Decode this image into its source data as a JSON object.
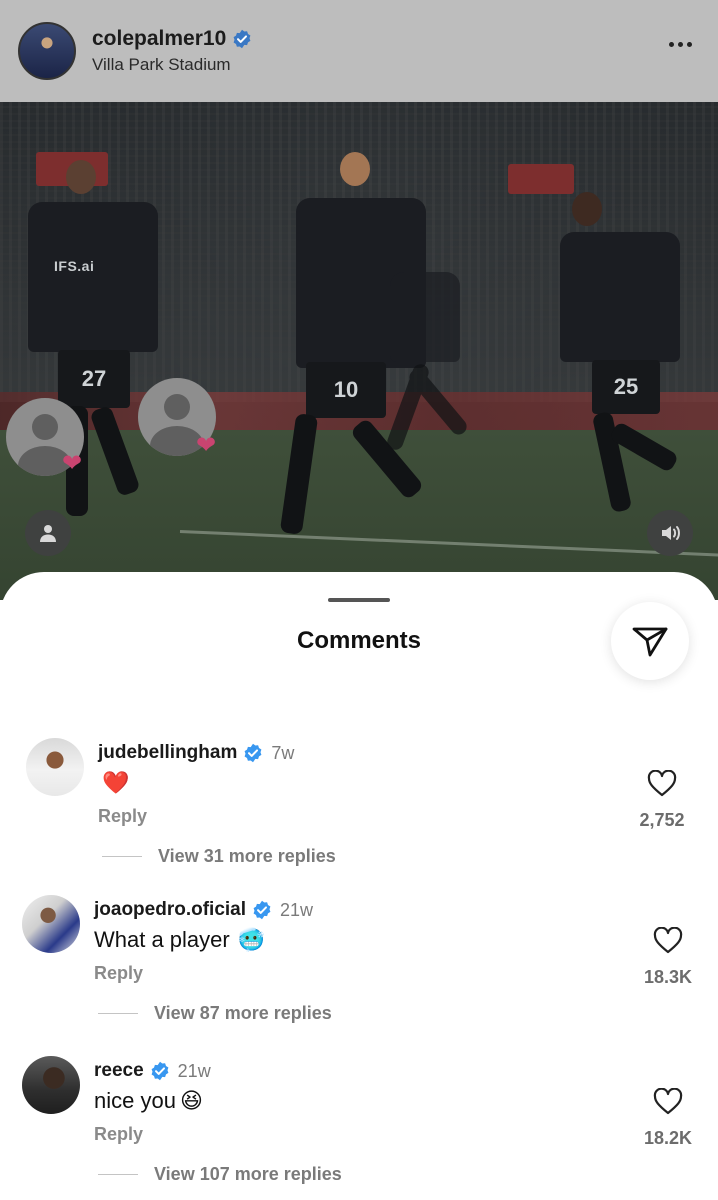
{
  "post": {
    "username": "colepalmer10",
    "location": "Villa Park Stadium",
    "verified": true,
    "avatar": "player-photo-avatar"
  },
  "video": {
    "jersey_numbers": [
      "27",
      "10",
      "25"
    ],
    "sponsor_text": "IFS.ai",
    "sound_icon": "speaker-icon",
    "profile_icon": "person-icon"
  },
  "comments_sheet": {
    "title": "Comments",
    "share_icon": "send-icon",
    "reply_label": "Reply",
    "items": [
      {
        "username": "judebellingham",
        "verified": true,
        "time": "7w",
        "text": "",
        "emoji": "❤️",
        "likes": "2,752",
        "view_replies": "View 31 more replies"
      },
      {
        "username": "joaopedro.oficial",
        "verified": true,
        "time": "21w",
        "text": "What a player",
        "emoji": "🥶",
        "likes": "18.3K",
        "view_replies": "View 87 more replies"
      },
      {
        "username": "reece",
        "verified": true,
        "time": "21w",
        "text": "nice you",
        "emoji": "😆",
        "likes": "18.2K",
        "view_replies": "View 107 more replies"
      }
    ]
  },
  "colors": {
    "verified_blue": "#3897f0",
    "heart_pink": "#c94470",
    "overlay_gray": "#bdbdbd"
  }
}
